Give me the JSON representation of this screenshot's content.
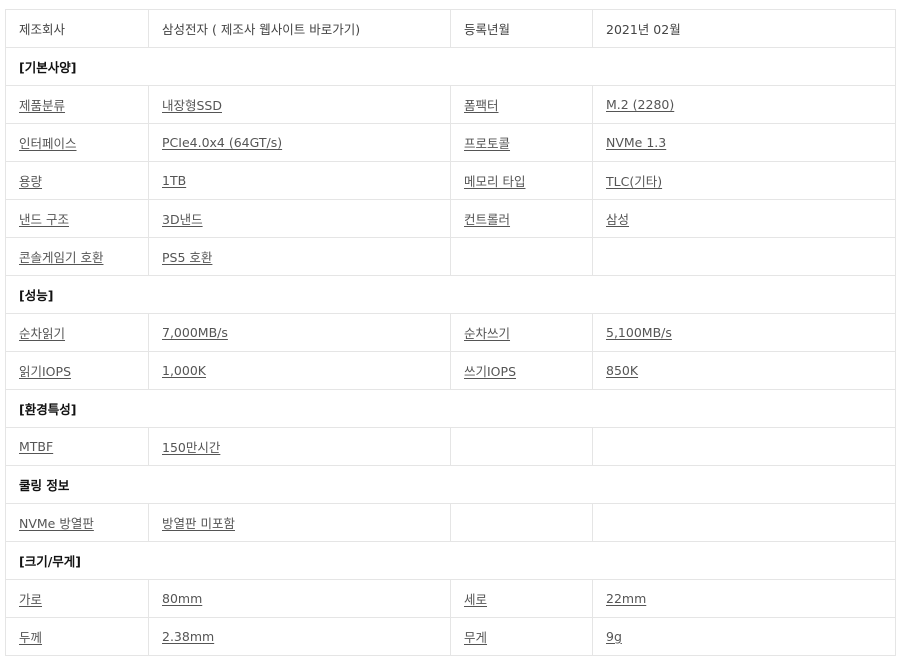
{
  "header": {
    "manufacturer_label": "제조회사",
    "manufacturer_value": "삼성전자 ( 제조사 웹사이트 바로가기)",
    "registered_label": "등록년월",
    "registered_value": "2021년 02월"
  },
  "sections": {
    "basic": "[기본사양]",
    "performance": "[성능]",
    "environment": "[환경특성]",
    "cooling": "쿨링 정보",
    "size": "[크기/무게]"
  },
  "rows": {
    "category": {
      "label": "제품분류",
      "value": "내장형SSD"
    },
    "form_factor": {
      "label": "폼팩터",
      "value": "M.2 (2280)"
    },
    "interface": {
      "label": "인터페이스",
      "value": "PCIe4.0x4 (64GT/s)"
    },
    "protocol": {
      "label": "프로토콜",
      "value": "NVMe 1.3"
    },
    "capacity": {
      "label": "용량",
      "value": "1TB"
    },
    "memory_type": {
      "label": "메모리 타입",
      "value": "TLC(기타)"
    },
    "nand": {
      "label": "낸드 구조",
      "value": "3D낸드"
    },
    "controller": {
      "label": "컨트롤러",
      "value": "삼성"
    },
    "console": {
      "label": "콘솔게임기 호환",
      "value": "PS5 호환"
    },
    "seq_read": {
      "label": "순차읽기",
      "value": "7,000MB/s"
    },
    "seq_write": {
      "label": "순차쓰기",
      "value": "5,100MB/s"
    },
    "read_iops": {
      "label": "읽기IOPS",
      "value": "1,000K"
    },
    "write_iops": {
      "label": "쓰기IOPS",
      "value": "850K"
    },
    "mtbf": {
      "label": "MTBF",
      "value": "150만시간"
    },
    "heatsink": {
      "label": "NVMe 방열판",
      "value": "방열판 미포함"
    },
    "width": {
      "label": "가로",
      "value": "80mm"
    },
    "height": {
      "label": "세로",
      "value": "22mm"
    },
    "thickness": {
      "label": "두께",
      "value": "2.38mm"
    },
    "weight": {
      "label": "무게",
      "value": "9g"
    }
  }
}
